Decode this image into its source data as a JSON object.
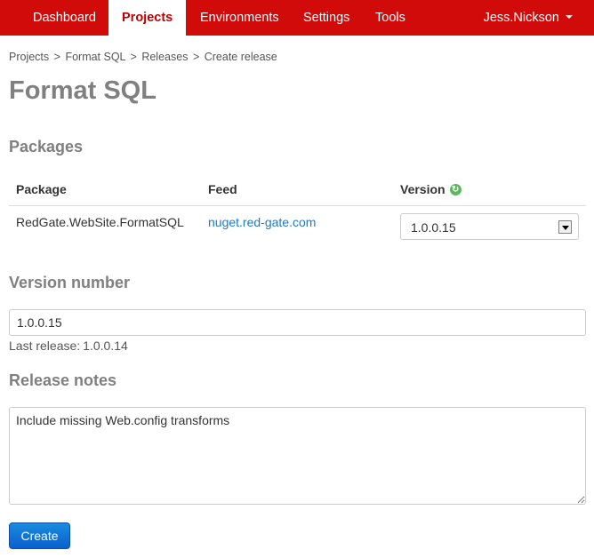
{
  "nav": {
    "items": [
      {
        "label": "Dashboard",
        "active": false
      },
      {
        "label": "Projects",
        "active": true
      },
      {
        "label": "Environments",
        "active": false
      },
      {
        "label": "Settings",
        "active": false
      },
      {
        "label": "Tools",
        "active": false
      }
    ],
    "user": "Jess.Nickson"
  },
  "breadcrumb": {
    "items": [
      "Projects",
      "Format SQL",
      "Releases",
      "Create release"
    ],
    "separator": ">"
  },
  "page": {
    "title": "Format SQL"
  },
  "packages": {
    "title": "Packages",
    "columns": {
      "package": "Package",
      "feed": "Feed",
      "version": "Version"
    },
    "rows": [
      {
        "package": "RedGate.WebSite.FormatSQL",
        "feed": "nuget.red-gate.com",
        "version": "1.0.0.15"
      }
    ]
  },
  "version_number": {
    "title": "Version number",
    "value": "1.0.0.15",
    "last_release_label": "Last release:",
    "last_release_value": "1.0.0.14"
  },
  "release_notes": {
    "title": "Release notes",
    "value": "Include missing Web.config transforms"
  },
  "actions": {
    "create_label": "Create"
  },
  "colors": {
    "navbar": "#d10a0a",
    "active_tab_text": "#c00000",
    "link": "#1f7bc1",
    "primary_button": "#0a5fcc",
    "heading_gray": "#808080"
  },
  "icons": {
    "refresh": "refresh-icon",
    "user_menu": "caret-down-icon"
  }
}
